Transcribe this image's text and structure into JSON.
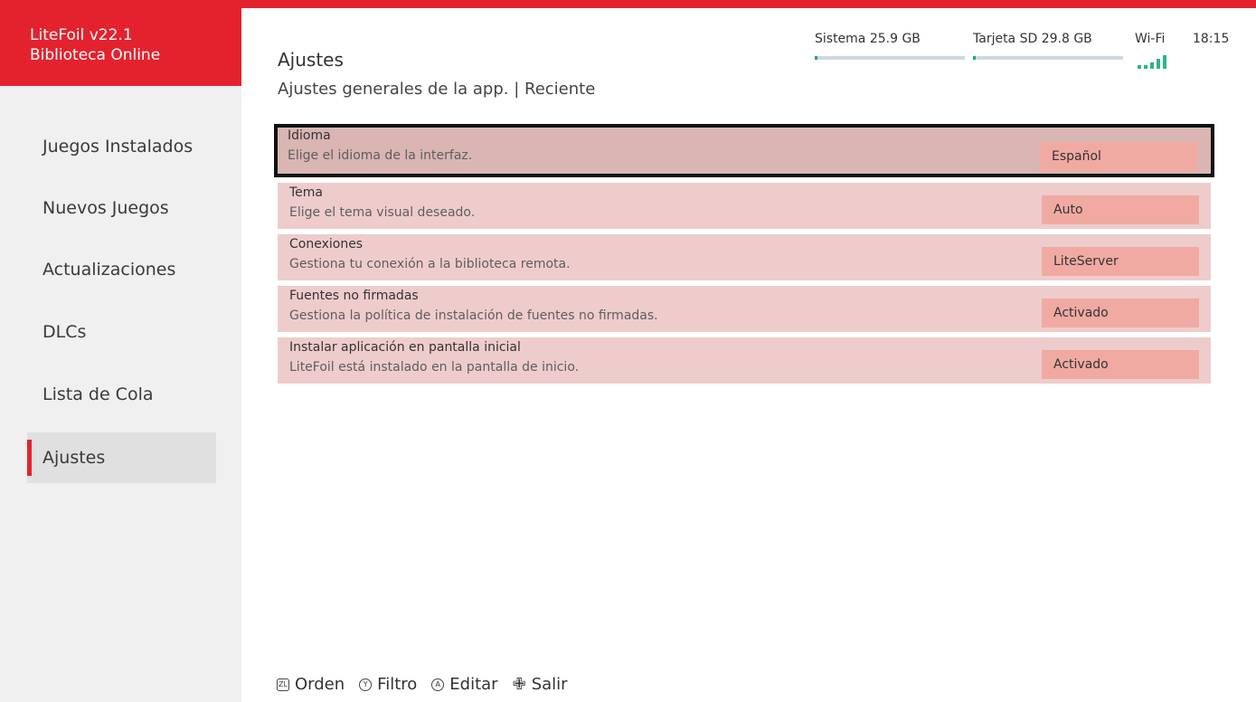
{
  "app": {
    "name": "LiteFoil v22.1",
    "section": "Biblioteca Online",
    "accent_color": "#e4222e"
  },
  "sidebar": {
    "items": [
      {
        "label": "Juegos Instalados",
        "active": false
      },
      {
        "label": "Nuevos Juegos",
        "active": false
      },
      {
        "label": "Actualizaciones",
        "active": false
      },
      {
        "label": "DLCs",
        "active": false
      },
      {
        "label": "Lista de Cola",
        "active": false
      },
      {
        "label": "Ajustes",
        "active": true
      }
    ]
  },
  "header": {
    "title": "Ajustes",
    "subtitle": "Ajustes generales de la app.  |  Reciente"
  },
  "status": {
    "system_label": "Sistema 25.9 GB",
    "system_usage": 0.02,
    "sd_label": "Tarjeta SD 29.8 GB",
    "sd_usage": 0.02,
    "wifi_label": "Wi-Fi",
    "wifi_icon": "wifi-signal-icon",
    "time": "18:15"
  },
  "settings": [
    {
      "title": "Idioma",
      "description": "Elige el idioma de la interfaz.",
      "value": "Español",
      "selected": true
    },
    {
      "title": "Tema",
      "description": "Elige el tema visual deseado.",
      "value": "Auto",
      "selected": false
    },
    {
      "title": "Conexiones",
      "description": "Gestiona tu conexión a la biblioteca remota.",
      "value": "LiteServer",
      "selected": false
    },
    {
      "title": "Fuentes no firmadas",
      "description": "Gestiona la política de instalación de fuentes no firmadas.",
      "value": "Activado",
      "selected": false
    },
    {
      "title": "Instalar aplicación en pantalla inicial",
      "description": "LiteFoil está instalado en la pantalla de inicio.",
      "value": "Activado",
      "selected": false
    }
  ],
  "footer": {
    "hints": [
      {
        "icon": "zl",
        "label": "Orden"
      },
      {
        "icon": "Y",
        "label": "Filtro"
      },
      {
        "icon": "A",
        "label": "Editar"
      },
      {
        "icon": "plus",
        "label": "Salir"
      }
    ]
  }
}
